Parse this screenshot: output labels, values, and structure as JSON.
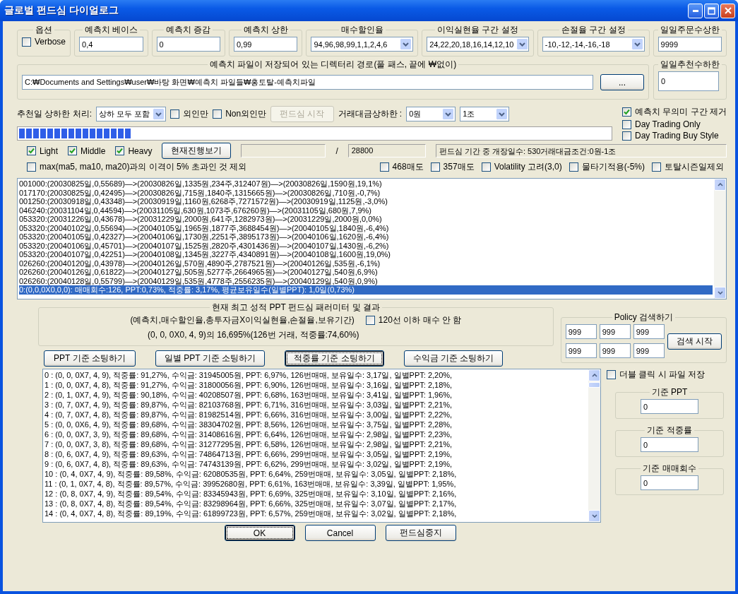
{
  "window": {
    "title": "글로벌 펀드심 다이얼로그"
  },
  "settings": [
    {
      "kind": "checkbox",
      "label": "옵션",
      "text": "Verbose",
      "checked": false
    },
    {
      "kind": "input",
      "label": "예측치 베이스",
      "value": "0,4"
    },
    {
      "kind": "input",
      "label": "예측치 증감",
      "value": "0"
    },
    {
      "kind": "input",
      "label": "예측치 상한",
      "value": "0,99"
    },
    {
      "kind": "combo",
      "label": "매수할인율",
      "value": "94,96,98,99,1,1,2,4,6"
    },
    {
      "kind": "combo",
      "label": "이익실현율 구간 설정",
      "value": "24,22,20,18,16,14,12,10"
    },
    {
      "kind": "combo",
      "label": "손절율 구간 설정",
      "value": "-10,-12,-14,-16,-18"
    },
    {
      "kind": "input",
      "label": "일일주문수상한",
      "value": "9999"
    }
  ],
  "path": {
    "label": "예측치 파일이 저장되어 있는 디렉터리 경로(풀 패스, 끝에 ₩없이)",
    "value": "C:₩Documents and Settings₩user₩바탕 화면₩예측치 파일들₩홍토탈-예측치파일",
    "browse": "..."
  },
  "min_recommend": {
    "label": "일일추천수하한",
    "value": "0"
  },
  "filter_row": [
    {
      "kind": "label",
      "text": "추천일 상하한 처리:"
    },
    {
      "kind": "combo",
      "value": "상하 모두 포함"
    },
    {
      "kind": "checkbox",
      "text": "외인만",
      "checked": false
    },
    {
      "kind": "checkbox",
      "text": "Non외인만",
      "checked": false
    },
    {
      "kind": "button",
      "text": "펀드심 시작",
      "disabled": true
    },
    {
      "kind": "label",
      "text": "거래대금상하한 :"
    },
    {
      "kind": "combo",
      "value": "0원"
    },
    {
      "kind": "combo",
      "value": "1조"
    }
  ],
  "progress": {
    "level": 0.19
  },
  "right_checks": [
    {
      "kind": "checkbox",
      "text": "예측치 무의미 구간 제거",
      "checked": true
    },
    {
      "kind": "checkbox",
      "text": "Day Trading Only",
      "checked": false
    },
    {
      "kind": "checkbox",
      "text": "Day Trading Buy Style",
      "checked": false
    }
  ],
  "weight_row": [
    {
      "kind": "checkbox",
      "text": "Light",
      "checked": true
    },
    {
      "kind": "checkbox",
      "text": "Middle",
      "checked": true
    },
    {
      "kind": "checkbox",
      "text": "Heavy",
      "checked": true
    },
    {
      "kind": "button",
      "text": "현재진행보기",
      "disabled": false
    },
    {
      "kind": "field"
    },
    {
      "kind": "label",
      "text": "/"
    },
    {
      "kind": "field",
      "value": "28800"
    },
    {
      "kind": "status",
      "text": "펀드심 기간 중 개장일수: 530거래대금조건:0원-1조"
    }
  ],
  "exclude_row": [
    {
      "kind": "checkbox",
      "text": "max(ma5, ma10, ma20)과의 이격이 5% 초과인 것 제외",
      "checked": false
    },
    {
      "kind": "spacer"
    },
    {
      "kind": "checkbox",
      "text": "468매도",
      "checked": false
    },
    {
      "kind": "checkbox",
      "text": "357매도",
      "checked": false
    },
    {
      "kind": "checkbox",
      "text": "Volatility 고려(3,0)",
      "checked": false
    },
    {
      "kind": "checkbox",
      "text": "물타기적용(-5%)",
      "checked": false
    },
    {
      "kind": "checkbox",
      "text": "토탈시즌일제외",
      "checked": false
    }
  ],
  "trade_log": [
    {
      "text": "001000:(20030825일,0,55689)—>(20030826일,1335원,234주,312407원)—>(20030826일,1590원,19,1%)",
      "selected": false
    },
    {
      "text": "017170:(20030825일,0,42495)—>(20030826일,715원,1840주,1315665원)—>(20030826일,710원,-0,7%)",
      "selected": false
    },
    {
      "text": "001250:(20030918일,0,43348)—>(20030919일,1160원,6268주,7271572원)—>(20030919일,1125원,-3,0%)",
      "selected": false
    },
    {
      "text": "046240:(20031104일,0,44594)—>(20031105일,630원,1073주,676260원)—>(20031105일,680원,7,9%)",
      "selected": false
    },
    {
      "text": "053320:(20031226일,0,43678)—>(20031229일,2000원,641주,1282973원)—>(20031229일,2000원,0,0%)",
      "selected": false
    },
    {
      "text": "053320:(20040102일,0,55694)—>(20040105일,1965원,1877주,3688454원)—>(20040105일,1840원,-6,4%)",
      "selected": false
    },
    {
      "text": "053320:(20040105일,0,42327)—>(20040106일,1730원,2251주,3895173원)—>(20040106일,1620원,-6,4%)",
      "selected": false
    },
    {
      "text": "053320:(20040106일,0,45701)—>(20040107일,1525원,2820주,4301436원)—>(20040107일,1430원,-6,2%)",
      "selected": false
    },
    {
      "text": "053320:(20040107일,0,42251)—>(20040108일,1345원,3227주,4340891원)—>(20040108일,1600원,19,0%)",
      "selected": false
    },
    {
      "text": "026260:(20040120일,0,43978)—>(20040126일,570원,4890주,2787521원)—>(20040126일,535원,-6,1%)",
      "selected": false
    },
    {
      "text": "026260:(20040126일,0,61822)—>(20040127일,505원,5277주,2664965원)—>(20040127일,540원,6,9%)",
      "selected": false
    },
    {
      "text": "026260:(20040128일,0,55799)—>(20040129일,535원,4778주,2556235원)—>(20040129일,540원,0,9%)",
      "selected": false
    },
    {
      "text": "0:(0,0,0X0,0,0): 매매회수:126, PPT:0,73%, 적중률: 3,17%, 평균보유일수(일별PPT): 1,0일(0,73%)",
      "selected": true
    }
  ],
  "best_result": {
    "label": "현재 최고 성적 PPT 펀드심 패러미터 및 결과",
    "legend_line": "(예측치,매수할인율,총투자금X이익실현율,손절율,보유기간)",
    "result": "(0, 0, 0X0, 4, 9)의 16,695%(126번 거래, 적중률:74,60%)",
    "option": {
      "text": "120선 이하 매수 안 함",
      "checked": false
    }
  },
  "policy": {
    "label": "Policy 검색하기",
    "values": [
      "999",
      "999",
      "999",
      "999",
      "999",
      "999"
    ],
    "button": "검색 시작"
  },
  "sort_buttons": [
    {
      "text": "PPT 기준 소팅하기",
      "focused": false
    },
    {
      "text": "일별 PPT 기준 소팅하기",
      "focused": false
    },
    {
      "text": "적중률 기준 소팅하기",
      "focused": true
    },
    {
      "text": "수익금 기준 소팅하기",
      "focused": false
    }
  ],
  "results": [
    "0 : (0, 0, 0X7, 4, 9), 적중률: 91,27%, 수익금: 31945005원, PPT: 6,97%, 126번매매, 보유일수: 3,17일, 일별PPT: 2,20%,",
    "1 : (0, 0, 0X7, 4, 8), 적중률: 91,27%, 수익금: 31800056원, PPT: 6,90%, 126번매매, 보유일수: 3,16일, 일별PPT: 2,18%,",
    "2 : (0, 1, 0X7, 4, 9), 적중률: 90,18%, 수익금: 40208507원, PPT: 6,68%, 163번매매, 보유일수: 3,41일, 일별PPT: 1,96%,",
    "3 : (0, 7, 0X7, 4, 9), 적중률: 89,87%, 수익금: 82103768원, PPT: 6,71%, 316번매매, 보유일수: 3,03일, 일별PPT: 2,21%,",
    "4 : (0, 7, 0X7, 4, 8), 적중률: 89,87%, 수익금: 81982514원, PPT: 6,66%, 316번매매, 보유일수: 3,00일, 일별PPT: 2,22%,",
    "5 : (0, 0, 0X6, 4, 9), 적중률: 89,68%, 수익금: 38304702원, PPT: 8,56%, 126번매매, 보유일수: 3,75일, 일별PPT: 2,28%,",
    "6 : (0, 0, 0X7, 3, 9), 적중률: 89,68%, 수익금: 31408616원, PPT: 6,64%, 126번매매, 보유일수: 2,98일, 일별PPT: 2,23%,",
    "7 : (0, 0, 0X7, 3, 8), 적중률: 89,68%, 수익금: 31277295원, PPT: 6,58%, 126번매매, 보유일수: 2,98일, 일별PPT: 2,21%,",
    "8 : (0, 6, 0X7, 4, 9), 적중률: 89,63%, 수익금: 74864713원, PPT: 6,66%, 299번매매, 보유일수: 3,05일, 일별PPT: 2,19%,",
    "9 : (0, 6, 0X7, 4, 8), 적중률: 89,63%, 수익금: 74743139원, PPT: 6,62%, 299번매매, 보유일수: 3,02일, 일별PPT: 2,19%,",
    "10 : (0, 4, 0X7, 4, 9), 적중률: 89,58%, 수익금: 62080535원, PPT: 6,64%, 259번매매, 보유일수: 3,05일, 일별PPT: 2,18%,",
    "11 : (0, 1, 0X7, 4, 8), 적중률: 89,57%, 수익금: 39952680원, PPT: 6,61%, 163번매매, 보유일수: 3,39일, 일별PPT: 1,95%,",
    "12 : (0, 8, 0X7, 4, 9), 적중률: 89,54%, 수익금: 83345943원, PPT: 6,69%, 325번매매, 보유일수: 3,10일, 일별PPT: 2,16%,",
    "13 : (0, 8, 0X7, 4, 8), 적중률: 89,54%, 수익금: 83298964원, PPT: 6,66%, 325번매매, 보유일수: 3,07일, 일별PPT: 2,17%,",
    "14 : (0, 4, 0X7, 4, 8), 적중률: 89,19%, 수익금: 61899723원, PPT: 6,57%, 259번매매, 보유일수: 3,02일, 일별PPT: 2,18%,"
  ],
  "result_options": {
    "save_on_double_click": {
      "text": "더블 클릭 시 파일 저장",
      "checked": false
    },
    "thresholds": [
      {
        "label": "기준 PPT",
        "value": "0"
      },
      {
        "label": "기준 적중률",
        "value": "0"
      },
      {
        "label": "기준 매매회수",
        "value": "0"
      }
    ]
  },
  "footer_buttons": [
    {
      "text": "OK",
      "focused": true
    },
    {
      "text": "Cancel",
      "focused": false
    },
    {
      "text": "펀드심중지",
      "focused": false
    }
  ]
}
